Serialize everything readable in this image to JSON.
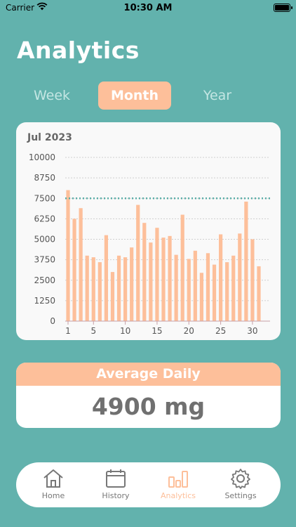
{
  "status": {
    "carrier": "Carrier",
    "time": "10:30 AM"
  },
  "title": "Analytics",
  "segments": [
    "Week",
    "Month",
    "Year"
  ],
  "selected_segment": "Month",
  "chart": {
    "period_label": "Jul 2023"
  },
  "chart_data": {
    "type": "bar",
    "title": "Jul 2023",
    "x": [
      1,
      2,
      3,
      4,
      5,
      6,
      7,
      8,
      9,
      10,
      11,
      12,
      13,
      14,
      15,
      16,
      17,
      18,
      19,
      20,
      21,
      22,
      23,
      24,
      25,
      26,
      27,
      28,
      29,
      30,
      31
    ],
    "values": [
      8000,
      6250,
      6900,
      4000,
      3900,
      3600,
      5250,
      3000,
      4000,
      3900,
      4500,
      7100,
      6000,
      4800,
      5700,
      5100,
      5200,
      4050,
      6500,
      3800,
      4300,
      2950,
      4150,
      3450,
      5300,
      3600,
      4000,
      5350,
      7300,
      5000,
      3350
    ],
    "y_ticks": [
      0,
      1250,
      2500,
      3750,
      5000,
      6250,
      7500,
      8750,
      10000
    ],
    "x_ticks": [
      1,
      5,
      10,
      15,
      20,
      25,
      30
    ],
    "ylim": [
      0,
      10000
    ],
    "reference_line": 7500,
    "grid": true,
    "colors": {
      "bar": "#fdbf9a",
      "reference_line": "#5aaea8",
      "grid": "#cfcfcf",
      "axis": "#c7a0a8"
    }
  },
  "average": {
    "header": "Average Daily",
    "value": "4900 mg"
  },
  "tabs": [
    {
      "label": "Home",
      "icon": "home-icon"
    },
    {
      "label": "History",
      "icon": "calendar-icon"
    },
    {
      "label": "Analytics",
      "icon": "bar-chart-icon"
    },
    {
      "label": "Settings",
      "icon": "gear-icon"
    }
  ],
  "selected_tab": "Analytics",
  "colors": {
    "background": "#62b2ad",
    "accent": "#fdbf9a",
    "card": "#f9f9f9"
  }
}
